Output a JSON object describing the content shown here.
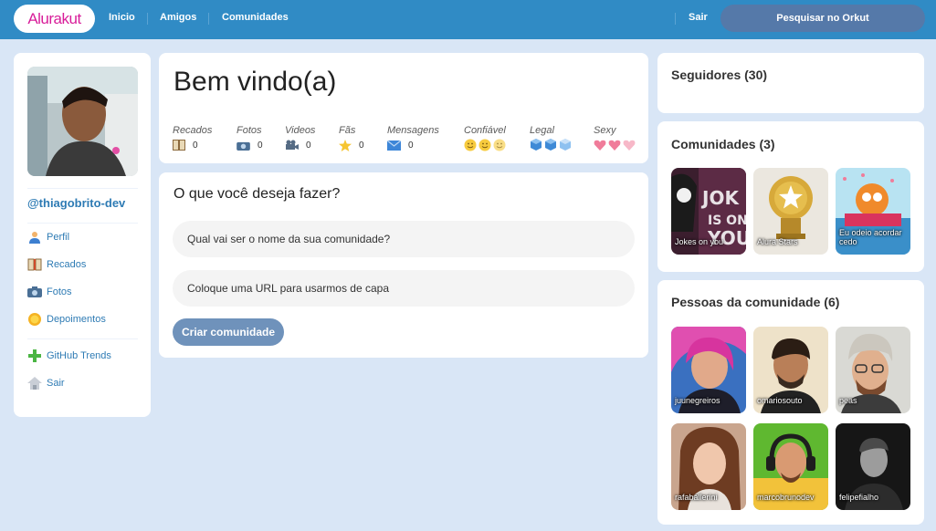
{
  "app": {
    "logo": "Alurakut"
  },
  "nav": {
    "inicio": "Inicio",
    "amigos": "Amigos",
    "comunidades": "Comunidades",
    "sair": "Sair"
  },
  "search": {
    "label": "Pesquisar no Orkut"
  },
  "profile": {
    "username": "@thiagobrito-dev",
    "menu": [
      {
        "label": "Perfil",
        "icon": "user-icon"
      },
      {
        "label": "Recados",
        "icon": "book-icon"
      },
      {
        "label": "Fotos",
        "icon": "camera-icon"
      },
      {
        "label": "Depoimentos",
        "icon": "sun-icon"
      },
      {
        "label": "GitHub Trends",
        "icon": "plus-icon"
      },
      {
        "label": "Sair",
        "icon": "home-icon"
      }
    ]
  },
  "welcome": {
    "title": "Bem vindo(a)",
    "stats": [
      {
        "label": "Recados",
        "value": "0",
        "icon": "book-icon"
      },
      {
        "label": "Fotos",
        "value": "0",
        "icon": "camera-icon"
      },
      {
        "label": "Videos",
        "value": "0",
        "icon": "video-camera-icon"
      },
      {
        "label": "Fãs",
        "value": "0",
        "icon": "star-icon"
      },
      {
        "label": "Mensagens",
        "value": "0",
        "icon": "envelope-icon"
      },
      {
        "label": "Confiável",
        "icon": "smiley-icon",
        "level": 3
      },
      {
        "label": "Legal",
        "icon": "ice-cube-icon",
        "level": 3
      },
      {
        "label": "Sexy",
        "icon": "heart-icon",
        "level": 3
      }
    ]
  },
  "create_community": {
    "title": "O que você deseja fazer?",
    "name_placeholder": "Qual vai ser o nome da sua comunidade?",
    "url_placeholder": "Coloque uma URL para usarmos de capa",
    "submit_label": "Criar comunidade"
  },
  "followers": {
    "title": "Seguidores (30)"
  },
  "communities": {
    "title": "Comunidades (3)",
    "items": [
      {
        "name": "Jokes on you"
      },
      {
        "name": "Alura Stars"
      },
      {
        "name": "Eu odeio acordar cedo"
      }
    ]
  },
  "people": {
    "title": "Pessoas da comunidade (6)",
    "items": [
      {
        "name": "juunegreiros"
      },
      {
        "name": "omariosouto"
      },
      {
        "name": "peas"
      },
      {
        "name": "rafaballerini"
      },
      {
        "name": "marcobrunodev"
      },
      {
        "name": "felipefialho"
      }
    ]
  },
  "colors": {
    "topbar": "#308BC5",
    "background": "#D9E6F6",
    "accent_link": "#2E7BB4",
    "logo": "#D81D99",
    "button": "#6F92BB"
  }
}
